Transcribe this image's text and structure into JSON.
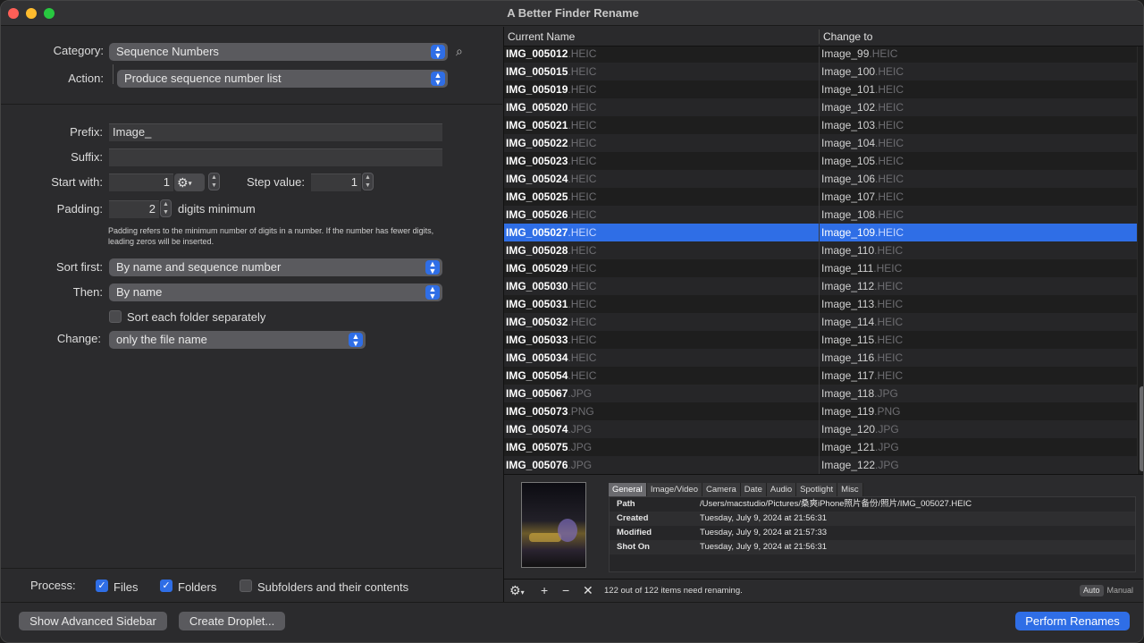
{
  "app": {
    "title": "A Better Finder Rename"
  },
  "left": {
    "category_label": "Category:",
    "category_value": "Sequence Numbers",
    "action_label": "Action:",
    "action_value": "Produce sequence number list",
    "prefix_label": "Prefix:",
    "prefix_value": "Image_",
    "suffix_label": "Suffix:",
    "suffix_value": "",
    "start_label": "Start with:",
    "start_value": "1",
    "step_label": "Step value:",
    "step_value": "1",
    "padding_label": "Padding:",
    "padding_value": "2",
    "padding_unit": "digits minimum",
    "padding_note": "Padding refers to the minimum number of digits in a number. If the number has fewer digits, leading zeros will be inserted.",
    "sort_first_label": "Sort first:",
    "sort_first_value": "By name and sequence number",
    "then_label": "Then:",
    "then_value": "By name",
    "sort_folder_label": "Sort each folder separately",
    "change_label": "Change:",
    "change_value": "only the file name",
    "process_label": "Process:",
    "files_label": "Files",
    "folders_label": "Folders",
    "subfolders_label": "Subfolders and their contents"
  },
  "table": {
    "col_current": "Current Name",
    "col_change": "Change to",
    "rows": [
      {
        "cur": "IMG_005012",
        "new": "Image_99",
        "ext": ".HEIC"
      },
      {
        "cur": "IMG_005015",
        "new": "Image_100",
        "ext": ".HEIC"
      },
      {
        "cur": "IMG_005019",
        "new": "Image_101",
        "ext": ".HEIC"
      },
      {
        "cur": "IMG_005020",
        "new": "Image_102",
        "ext": ".HEIC"
      },
      {
        "cur": "IMG_005021",
        "new": "Image_103",
        "ext": ".HEIC"
      },
      {
        "cur": "IMG_005022",
        "new": "Image_104",
        "ext": ".HEIC"
      },
      {
        "cur": "IMG_005023",
        "new": "Image_105",
        "ext": ".HEIC"
      },
      {
        "cur": "IMG_005024",
        "new": "Image_106",
        "ext": ".HEIC"
      },
      {
        "cur": "IMG_005025",
        "new": "Image_107",
        "ext": ".HEIC"
      },
      {
        "cur": "IMG_005026",
        "new": "Image_108",
        "ext": ".HEIC"
      },
      {
        "cur": "IMG_005027",
        "new": "Image_109",
        "ext": ".HEIC"
      },
      {
        "cur": "IMG_005028",
        "new": "Image_110",
        "ext": ".HEIC"
      },
      {
        "cur": "IMG_005029",
        "new": "Image_111",
        "ext": ".HEIC"
      },
      {
        "cur": "IMG_005030",
        "new": "Image_112",
        "ext": ".HEIC"
      },
      {
        "cur": "IMG_005031",
        "new": "Image_113",
        "ext": ".HEIC"
      },
      {
        "cur": "IMG_005032",
        "new": "Image_114",
        "ext": ".HEIC"
      },
      {
        "cur": "IMG_005033",
        "new": "Image_115",
        "ext": ".HEIC"
      },
      {
        "cur": "IMG_005034",
        "new": "Image_116",
        "ext": ".HEIC"
      },
      {
        "cur": "IMG_005054",
        "new": "Image_117",
        "ext": ".HEIC"
      },
      {
        "cur": "IMG_005067",
        "new": "Image_118",
        "ext": ".JPG"
      },
      {
        "cur": "IMG_005073",
        "new": "Image_119",
        "ext": ".PNG"
      },
      {
        "cur": "IMG_005074",
        "new": "Image_120",
        "ext": ".JPG"
      },
      {
        "cur": "IMG_005075",
        "new": "Image_121",
        "ext": ".JPG"
      },
      {
        "cur": "IMG_005076",
        "new": "Image_122",
        "ext": ".JPG"
      }
    ],
    "selected_index": 10
  },
  "info": {
    "tabs": [
      "General",
      "Image/Video",
      "Camera",
      "Date",
      "Audio",
      "Spotlight",
      "Misc"
    ],
    "active_tab": "General",
    "fields": [
      {
        "key": "Path",
        "value": "/Users/macstudio/Pictures/桑爽iPhone照片备份/照片/IMG_005027.HEIC"
      },
      {
        "key": "Created",
        "value": "Tuesday, July 9, 2024 at 21:56:31"
      },
      {
        "key": "Modified",
        "value": "Tuesday, July 9, 2024 at 21:57:33"
      },
      {
        "key": "Shot On",
        "value": "Tuesday, July 9, 2024 at 21:56:31"
      }
    ],
    "status": "122 out of 122 items need renaming.",
    "seg_auto": "Auto",
    "seg_manual": "Manual"
  },
  "bottom": {
    "advanced_sidebar": "Show Advanced Sidebar",
    "create_droplet": "Create Droplet...",
    "perform_renames": "Perform Renames"
  },
  "colors": {
    "accent": "#2f6ee6",
    "selection": "#2f6ee6"
  }
}
